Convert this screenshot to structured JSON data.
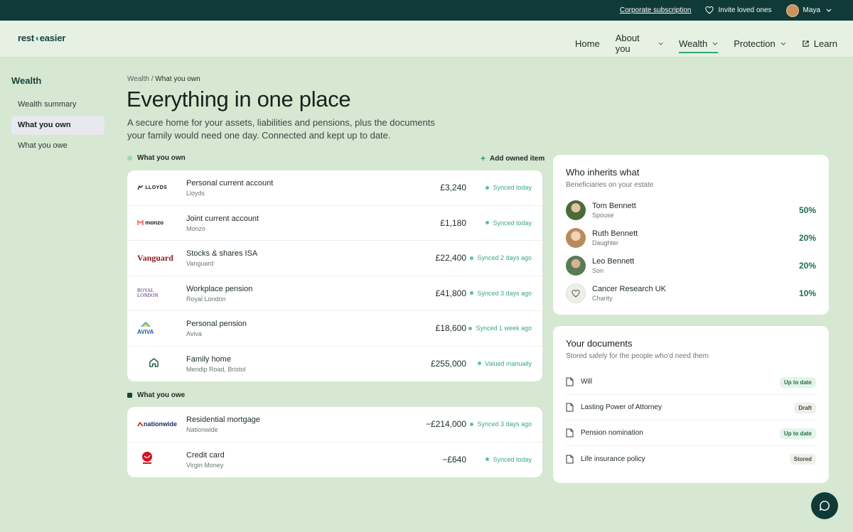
{
  "topbar": {
    "corporate": "Corporate subscription",
    "invite": "Invite loved ones",
    "user": "Maya"
  },
  "brand": {
    "logo_pre": "rest",
    "logo_mid": "",
    "logo_post": "easier"
  },
  "nav": {
    "home": "Home",
    "about": "About you",
    "wealth": "Wealth",
    "protection": "Protection",
    "learn": "Learn"
  },
  "sidebar": {
    "title": "Wealth",
    "items": [
      {
        "label": "Wealth summary"
      },
      {
        "label": "What you own"
      },
      {
        "label": "What you owe"
      }
    ]
  },
  "header": {
    "crumb_root": "Wealth /",
    "crumb_current": "What you own",
    "title": "Everything in one place",
    "lead": "A secure home for your assets, liabilities and pensions, plus the documents your family would need one day. Connected and kept up to date."
  },
  "own": {
    "heading": "What you own",
    "add_label": "Add owned item",
    "rows": [
      {
        "logo": "LLOYDS",
        "name": "Personal current account",
        "sub": "Lloyds",
        "amount": "£3,240",
        "status": "Synced today"
      },
      {
        "logo": "monzo",
        "name": "Joint current account",
        "sub": "Monzo",
        "amount": "£1,180",
        "status": "Synced today"
      },
      {
        "logo": "Vanguard",
        "name": "Stocks & shares ISA",
        "sub": "Vanguard",
        "amount": "£22,400",
        "status": "Synced 2 days ago"
      },
      {
        "logo_line1": "ROYAL",
        "logo_line2": "LONDON",
        "name": "Workplace pension",
        "sub": "Royal London",
        "amount": "£41,800",
        "status": "Synced 3 days ago"
      },
      {
        "logo": "AVIVA",
        "name": "Personal pension",
        "sub": "Aviva",
        "amount": "£18,600",
        "status": "Synced 1 week ago"
      },
      {
        "logo": "home-icon",
        "name": "Family home",
        "sub": "Mendip Road, Bristol",
        "amount": "£255,000",
        "status": "Valued manually"
      }
    ]
  },
  "owe": {
    "heading": "What you owe",
    "rows": [
      {
        "logo": "nationwide",
        "name": "Residential mortgage",
        "sub": "Nationwide",
        "amount": "−£214,000",
        "status": "Synced 3 days ago"
      },
      {
        "logo": "virgin-money-logo",
        "name": "Credit card",
        "sub": "Virgin Money",
        "amount": "−£640",
        "status": "Synced today"
      }
    ]
  },
  "heirs": {
    "title": "Who inherits what",
    "subtitle": "Beneficiaries on your estate",
    "people": [
      {
        "name": "Tom Bennett",
        "relation": "Spouse",
        "share": "50%"
      },
      {
        "name": "Ruth Bennett",
        "relation": "Daughter",
        "share": "20%"
      },
      {
        "name": "Leo Bennett",
        "relation": "Son",
        "share": "20%"
      },
      {
        "name": "Cancer Research UK",
        "relation": "Charity",
        "share": "10%"
      }
    ]
  },
  "documents": {
    "title": "Your documents",
    "subtitle": "Stored safely for the people who'd need them",
    "items": [
      {
        "name": "Will",
        "badge": "Up to date"
      },
      {
        "name": "Lasting Power of Attorney",
        "badge": "Draft"
      },
      {
        "name": "Pension nomination",
        "badge": "Up to date"
      },
      {
        "name": "Life insurance policy",
        "badge": "Stored"
      }
    ]
  },
  "colors": {
    "topbar": "#0f3a38",
    "page_bg": "#d6e8d2",
    "accent": "#2fa67a",
    "status_green": "#3aa87a"
  }
}
